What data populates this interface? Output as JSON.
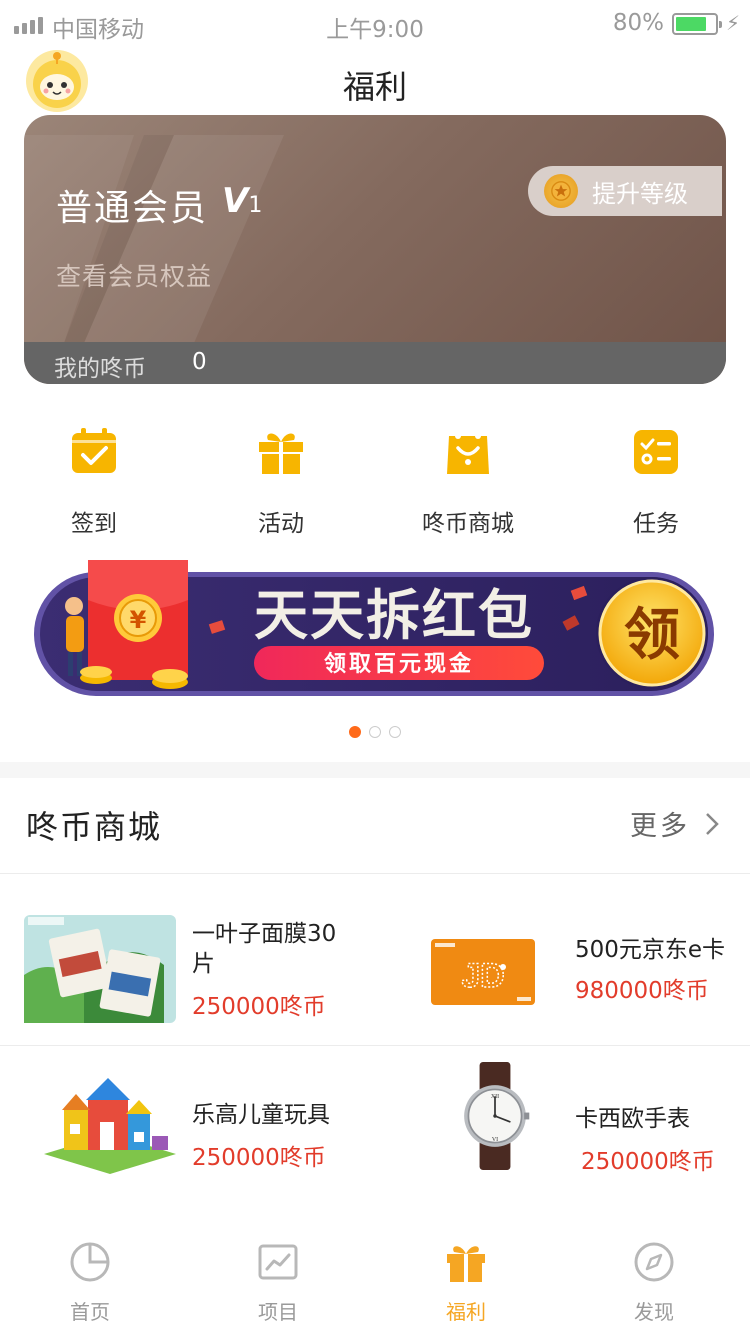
{
  "status_bar": {
    "carrier": "中国移动",
    "time": "上午9:00",
    "battery": "80%",
    "battery_level": 0.8
  },
  "header": {
    "title": "福利"
  },
  "member_card": {
    "level": "普通会员",
    "vip_prefix": "V",
    "vip_level": "1",
    "view_benefits": "查看会员权益",
    "upgrade_label": "提升等级",
    "coins_label": "我的咚币",
    "coins_value": "0"
  },
  "quick_menu": [
    {
      "label": "签到",
      "icon": "calendar-check-icon"
    },
    {
      "label": "活动",
      "icon": "gift-icon"
    },
    {
      "label": "咚币商城",
      "icon": "shopping-bag-icon"
    },
    {
      "label": "任务",
      "icon": "task-list-icon"
    }
  ],
  "banner": {
    "title": "天天拆红包",
    "subtitle": "领取百元现金",
    "button": "领",
    "currency": "¥",
    "slides": 3,
    "active_slide": 1
  },
  "mall": {
    "title": "咚币商城",
    "more": "更多",
    "products": [
      {
        "name_line1": "一叶子面膜30",
        "name_line2": "片",
        "price": "250000咚币"
      },
      {
        "name_line1": "500元京东e卡",
        "name_line2": "",
        "price": "980000咚币"
      },
      {
        "name_line1": "乐高儿童玩具",
        "name_line2": "",
        "price": "250000咚币"
      },
      {
        "name_line1": "卡西欧手表",
        "name_line2": "",
        "price": "250000咚币"
      }
    ]
  },
  "tab_bar": [
    {
      "label": "首页",
      "icon": "pie-chart-icon",
      "active": false
    },
    {
      "label": "项目",
      "icon": "line-chart-icon",
      "active": false
    },
    {
      "label": "福利",
      "icon": "gift-icon",
      "active": true
    },
    {
      "label": "发现",
      "icon": "compass-icon",
      "active": false
    }
  ],
  "colors": {
    "accent": "#f5a623",
    "price": "#e23c2b",
    "card": "#846a5e",
    "dot_active": "#ff6a1a"
  }
}
